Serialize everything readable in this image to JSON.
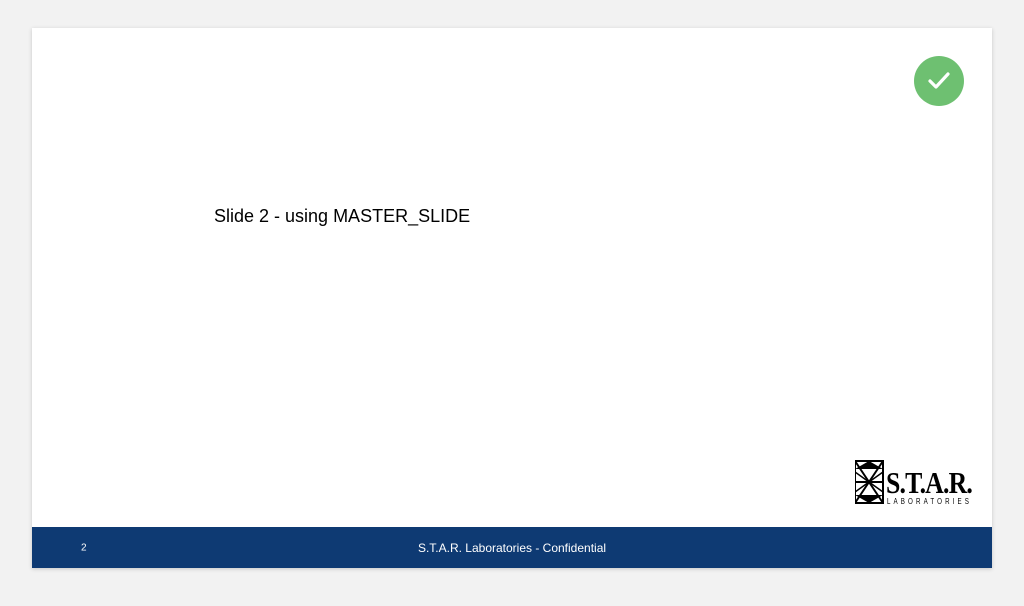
{
  "slide": {
    "title": "Slide 2 - using MASTER_SLIDE",
    "page_number": "2",
    "footer_text": "S.T.A.R. Laboratories - Confidential",
    "check_color": "#6ec071",
    "footer_bg": "#0e3a73",
    "logo_main": "S.T.A.R.",
    "logo_sub": "LABORATORIES"
  }
}
